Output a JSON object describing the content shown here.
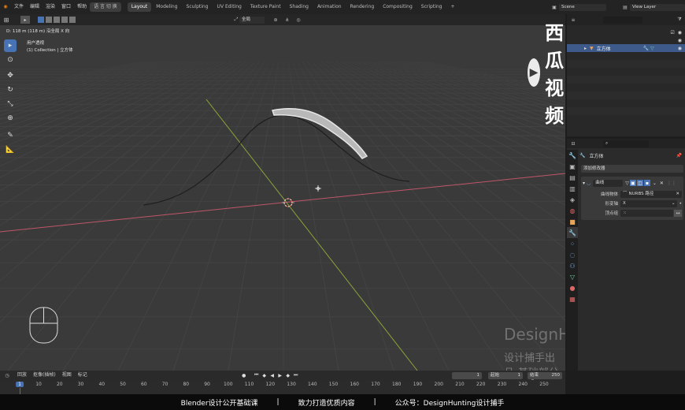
{
  "menu": {
    "items": [
      "文件",
      "编辑",
      "渲染",
      "窗口",
      "帮助"
    ],
    "mode_label": "语 言 切 换"
  },
  "workspaces": [
    "Layout",
    "Modeling",
    "Sculpting",
    "UV Editing",
    "Texture Paint",
    "Shading",
    "Animation",
    "Rendering",
    "Compositing",
    "Scripting"
  ],
  "add_workspace": "+",
  "scene": {
    "label": "Scene",
    "view_layer": "View Layer"
  },
  "viewport": {
    "measure_text": "D: 118 m (118 m) 沿全局 X 向",
    "view_name": "用户透视",
    "collection_info": "(1) Collection | 立方体",
    "global_label": "全局"
  },
  "watermark": {
    "brand": "西瓜视频",
    "title": "DesignHunting",
    "subtitle": "设计捕手出品-基础部分"
  },
  "outliner": {
    "object_name": "立方体"
  },
  "properties": {
    "object_name": "立方体",
    "add_modifier": "添加修改器",
    "modifier_name": "曲线",
    "curve_object_label": "曲线物体",
    "curve_object_value": "NURBS 路径",
    "deform_axis_label": "形变轴",
    "deform_axis_value": "X",
    "vertex_group_label": "顶点组"
  },
  "timeline": {
    "menu": [
      "回放",
      "抠像(插帧)",
      "视图",
      "标记"
    ],
    "current_frame": "1",
    "start_label": "起始",
    "start_value": "1",
    "end_label": "结束点",
    "end_value": "250",
    "ticks": [
      "1",
      "10",
      "20",
      "30",
      "40",
      "50",
      "60",
      "70",
      "80",
      "90",
      "100",
      "110",
      "120",
      "130",
      "140",
      "150",
      "160",
      "170",
      "180",
      "190",
      "200",
      "210",
      "220",
      "230",
      "240",
      "250"
    ]
  },
  "footer": {
    "part1": "Blender设计公开基础课",
    "part2": "致力打造优质内容",
    "part3": "公众号：DesignHunting设计捕手",
    "separator": "|"
  },
  "colors": {
    "accent": "#4772b3",
    "x_axis": "#c0566a",
    "y_axis": "#8aa33a",
    "curve": "#1e1e1e",
    "selected": "#3d5a8a"
  }
}
